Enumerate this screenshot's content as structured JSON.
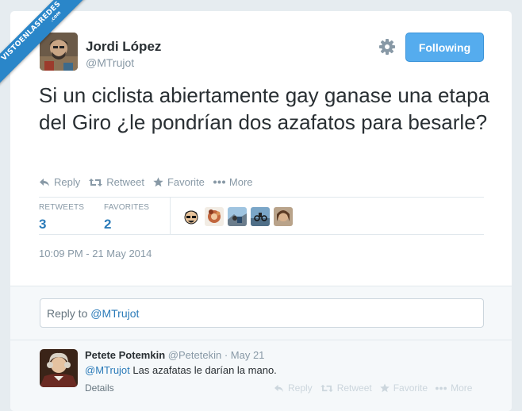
{
  "watermark": {
    "line1": "VISTOENLASREDES",
    "line2": ".com"
  },
  "tweet": {
    "author_name": "Jordi López",
    "author_handle": "@MTrujot",
    "follow_label": "Following",
    "text": "Si un ciclista abiertamente gay ganase una etapa del Giro ¿le pondrían dos azafatos para besarle?",
    "actions": {
      "reply": "Reply",
      "retweet": "Retweet",
      "favorite": "Favorite",
      "more": "More"
    },
    "stats": {
      "retweets_label": "RETWEETS",
      "retweets_count": "3",
      "favorites_label": "FAVORITES",
      "favorites_count": "2"
    },
    "timestamp": "10:09 PM - 21 May 2014"
  },
  "reply_box": {
    "prefix": "Reply to ",
    "mention": "@MTrujot"
  },
  "reply": {
    "name": "Petete Potemkin",
    "handle": "@Petetekin",
    "separator": "·",
    "date": "May 21",
    "mention": "@MTrujot",
    "text": " Las azafatas le darían la mano.",
    "details": "Details",
    "actions": {
      "reply": "Reply",
      "retweet": "Retweet",
      "favorite": "Favorite",
      "more": "More"
    }
  },
  "colors": {
    "accent": "#55acee",
    "link": "#2b7bb9",
    "muted": "#8899a6",
    "background": "#e6ecf0"
  },
  "icons": [
    "gear-icon",
    "reply-icon",
    "retweet-icon",
    "star-icon",
    "more-icon"
  ]
}
